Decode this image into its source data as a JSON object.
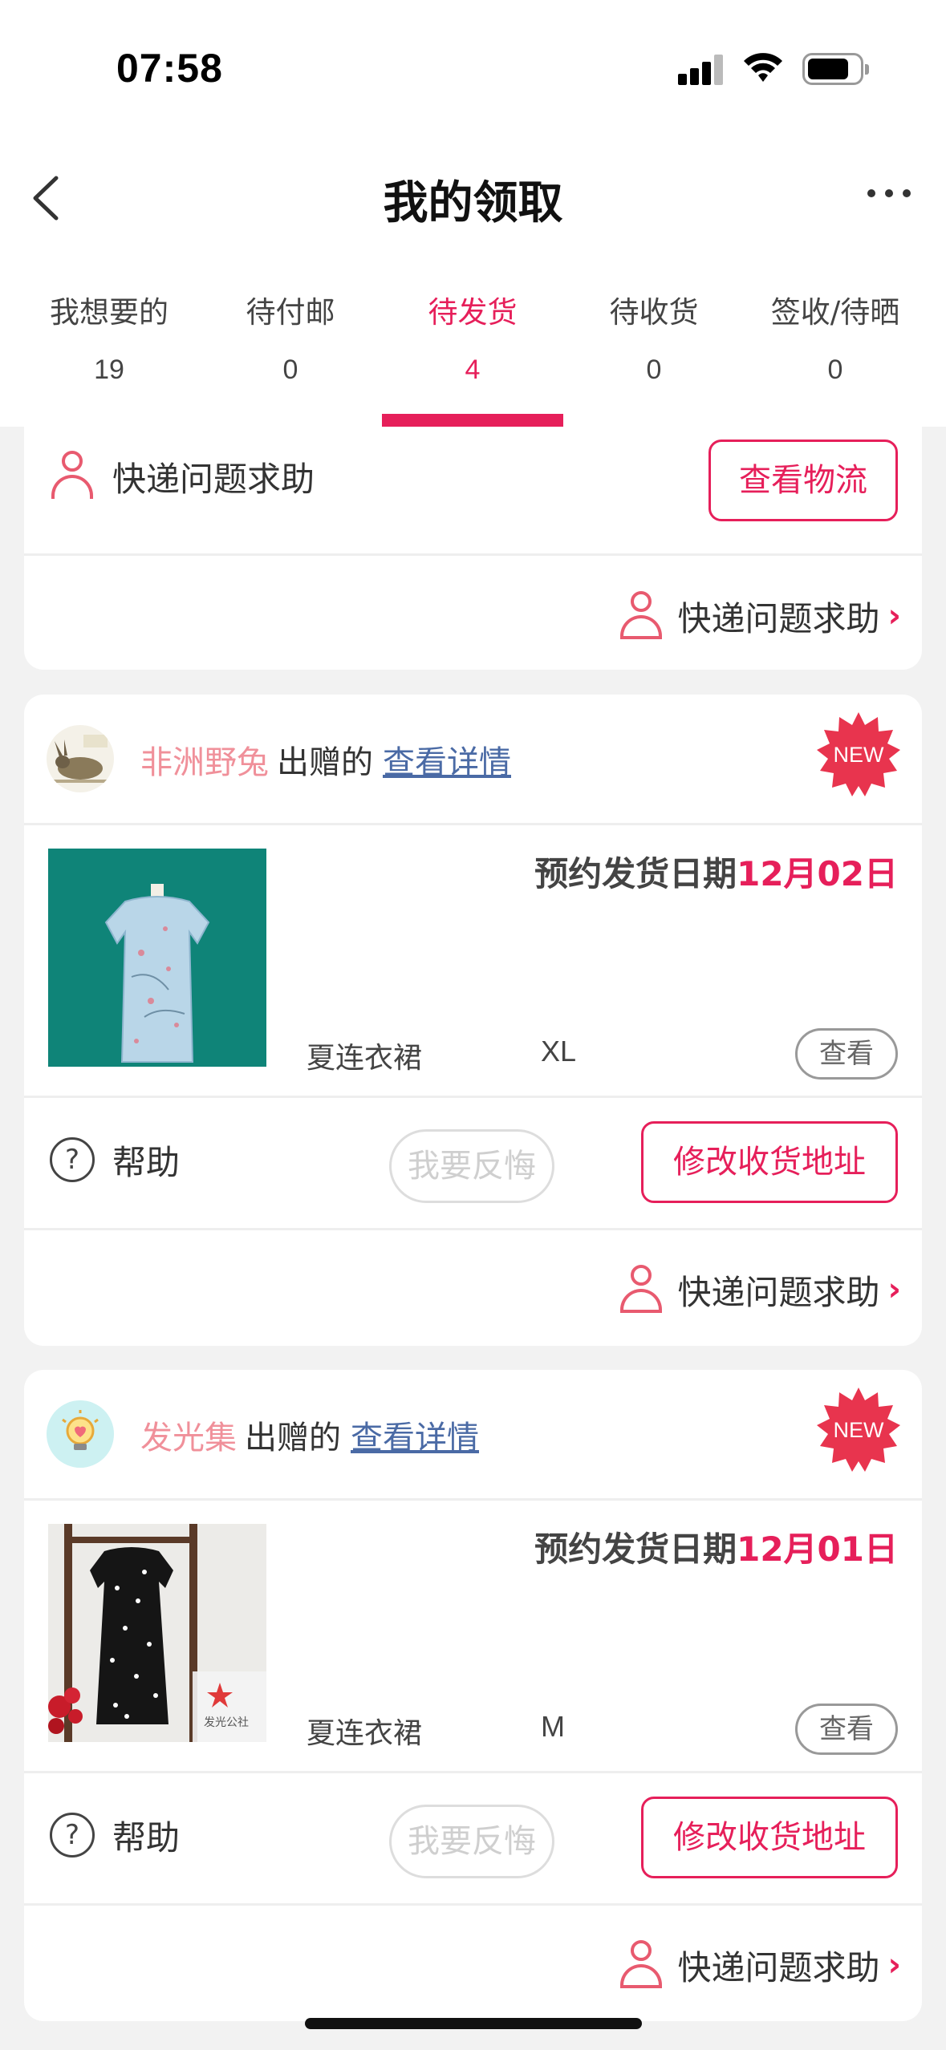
{
  "status_bar": {
    "time": "07:58"
  },
  "nav": {
    "title": "我的领取"
  },
  "tabs": [
    {
      "label": "我想要的",
      "count": "19"
    },
    {
      "label": "待付邮",
      "count": "0"
    },
    {
      "label": "待发货",
      "count": "4"
    },
    {
      "label": "待收货",
      "count": "0"
    },
    {
      "label": "签收/待晒",
      "count": "0"
    }
  ],
  "active_tab": "待发货",
  "partial_card": {
    "help_text": "快递问题求助",
    "logistics_button": "查看物流",
    "express_link": "快递问题求助"
  },
  "orders": [
    {
      "giver_name": "非洲野兔",
      "giver_suffix": "出赠的",
      "detail_link": "查看详情",
      "badge": "NEW",
      "ship_label": "预约发货日期",
      "ship_date": "12月02日",
      "product_name": "夏连衣裙",
      "product_size": "XL",
      "view_button": "查看",
      "help_label": "帮助",
      "regret_button": "我要反悔",
      "modify_address_button": "修改收货地址",
      "express_link": "快递问题求助"
    },
    {
      "giver_name": "发光集",
      "giver_suffix": "出赠的",
      "detail_link": "查看详情",
      "badge": "NEW",
      "ship_label": "预约发货日期",
      "ship_date": "12月01日",
      "product_name": "夏连衣裙",
      "product_size": "M",
      "view_button": "查看",
      "help_label": "帮助",
      "regret_button": "我要反悔",
      "modify_address_button": "修改收货地址",
      "express_link": "快递问题求助",
      "image_watermark": "发光公社"
    }
  ],
  "colors": {
    "accent": "#e61f5a",
    "giver_name": "#f0909a",
    "link": "#4a6aa5",
    "badge": "#e8344e"
  }
}
